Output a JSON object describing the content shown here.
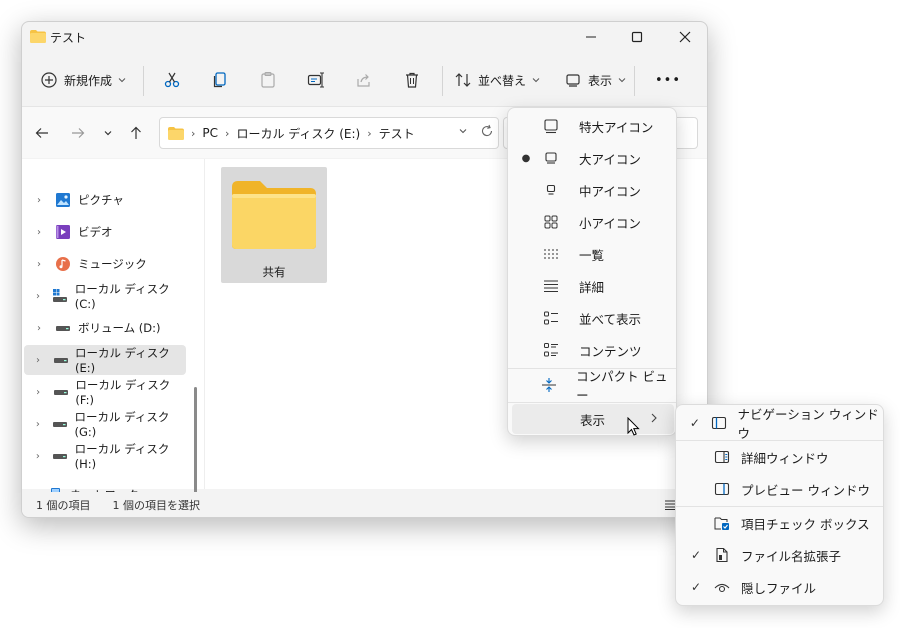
{
  "window": {
    "title": "テスト"
  },
  "toolbar": {
    "new_label": "新規作成",
    "sort_label": "並べ替え",
    "view_label": "表示",
    "more_label": "•••"
  },
  "navigation": {
    "breadcrumbs": [
      "PC",
      "ローカル ディスク (E:)",
      "テスト"
    ]
  },
  "sidebar": {
    "items": [
      {
        "label": "ピクチャ",
        "icon": "pictures-icon"
      },
      {
        "label": "ビデオ",
        "icon": "videos-icon"
      },
      {
        "label": "ミュージック",
        "icon": "music-icon"
      },
      {
        "label": "ローカル ディスク (C:)",
        "icon": "system-drive-icon"
      },
      {
        "label": "ボリューム (D:)",
        "icon": "drive-icon"
      },
      {
        "label": "ローカル ディスク (E:)",
        "icon": "drive-icon",
        "selected": true
      },
      {
        "label": "ローカル ディスク (F:)",
        "icon": "drive-icon"
      },
      {
        "label": "ローカル ディスク (G:)",
        "icon": "drive-icon"
      },
      {
        "label": "ローカル ディスク (H:)",
        "icon": "drive-icon"
      },
      {
        "label": "ネットワーク",
        "icon": "network-icon"
      }
    ]
  },
  "files": [
    {
      "name": "共有",
      "type": "folder",
      "selected": true
    }
  ],
  "status": {
    "count": "1 個の項目",
    "selection": "1 個の項目を選択"
  },
  "view_menu": {
    "items": [
      {
        "label": "特大アイコン",
        "icon": "extra-large-icons-icon",
        "selected": false
      },
      {
        "label": "大アイコン",
        "icon": "large-icons-icon",
        "selected": true
      },
      {
        "label": "中アイコン",
        "icon": "medium-icons-icon",
        "selected": false
      },
      {
        "label": "小アイコン",
        "icon": "small-icons-icon",
        "selected": false
      },
      {
        "label": "一覧",
        "icon": "list-icon",
        "selected": false
      },
      {
        "label": "詳細",
        "icon": "details-icon",
        "selected": false
      },
      {
        "label": "並べて表示",
        "icon": "tiles-icon",
        "selected": false
      },
      {
        "label": "コンテンツ",
        "icon": "content-icon",
        "selected": false
      }
    ],
    "compact_label": "コンパクト ビュー",
    "show_label": "表示"
  },
  "show_submenu": {
    "items": [
      {
        "label": "ナビゲーション ウィンドウ",
        "checked": true,
        "icon": "navigation-pane-icon"
      },
      {
        "label": "詳細ウィンドウ",
        "checked": false,
        "icon": "details-pane-icon"
      },
      {
        "label": "プレビュー ウィンドウ",
        "checked": false,
        "icon": "preview-pane-icon"
      },
      {
        "label": "項目チェック ボックス",
        "checked": false,
        "icon": "item-checkbox-icon"
      },
      {
        "label": "ファイル名拡張子",
        "checked": true,
        "icon": "file-extension-icon"
      },
      {
        "label": "隠しファイル",
        "checked": true,
        "icon": "hidden-items-icon"
      }
    ]
  },
  "colors": {
    "accent": "#0067c0",
    "folder": "#f6c344",
    "selected_bg": "#d9d9d9"
  }
}
